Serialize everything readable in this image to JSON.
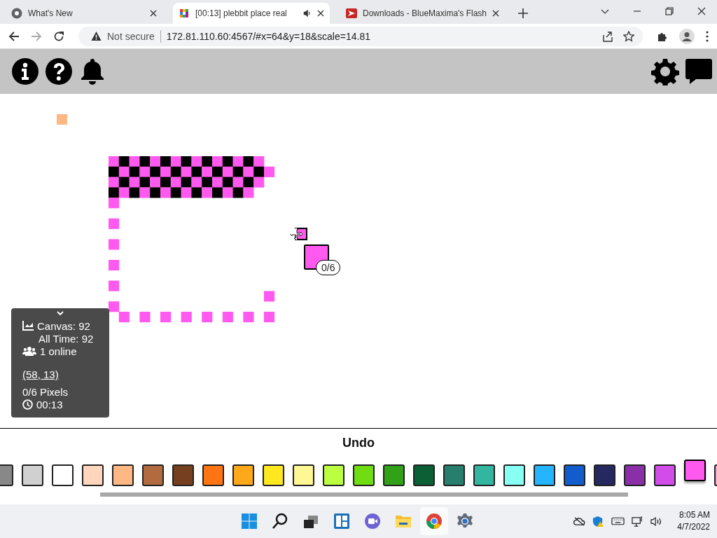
{
  "browser": {
    "tabs": [
      {
        "title": "What's New",
        "selected": false,
        "playing_audio": false,
        "kind": "chrome"
      },
      {
        "title": "[00:13] plebbit place real",
        "selected": true,
        "playing_audio": true,
        "kind": "grid"
      },
      {
        "title": "Downloads - BlueMaxima's Flash",
        "selected": false,
        "playing_audio": false,
        "kind": "flash"
      }
    ],
    "address_bar": {
      "security": "Not secure",
      "url": "172.81.110.60:4567/#x=64&y=18&scale=14.81"
    }
  },
  "canvas": {
    "pixel_counter": "0/6"
  },
  "info_panel": {
    "canvas_count": "Canvas: 92",
    "all_time": "All Time: 92",
    "online": "1 online",
    "coordinates": "(58, 13)",
    "pixels": "0/6 Pixels",
    "timer": "00:13"
  },
  "bottom_bar": {
    "undo": "Undo",
    "palette": [
      {
        "color": "#888888",
        "selected": false
      },
      {
        "color": "#d0d0d0",
        "selected": false
      },
      {
        "color": "#ffffff",
        "selected": false
      },
      {
        "color": "#ffd5bc",
        "selected": false
      },
      {
        "color": "#ffb783",
        "selected": false
      },
      {
        "color": "#b26b3e",
        "selected": false
      },
      {
        "color": "#763f1e",
        "selected": false
      },
      {
        "color": "#ff7514",
        "selected": false
      },
      {
        "color": "#ffa91a",
        "selected": false
      },
      {
        "color": "#ffe81f",
        "selected": false
      },
      {
        "color": "#fff694",
        "selected": false
      },
      {
        "color": "#bbff40",
        "selected": false
      },
      {
        "color": "#70dd13",
        "selected": false
      },
      {
        "color": "#31a117",
        "selected": false
      },
      {
        "color": "#0b5f35",
        "selected": false
      },
      {
        "color": "#277e6c",
        "selected": false
      },
      {
        "color": "#32b69f",
        "selected": false
      },
      {
        "color": "#88fff3",
        "selected": false
      },
      {
        "color": "#24b5fe",
        "selected": false
      },
      {
        "color": "#125ccb",
        "selected": false
      },
      {
        "color": "#262960",
        "selected": false
      },
      {
        "color": "#8b2fa8",
        "selected": false
      },
      {
        "color": "#d24cea",
        "selected": false
      },
      {
        "color": "#ff59ef",
        "selected": true
      },
      {
        "color": "#ffa9d9",
        "selected": false
      }
    ]
  },
  "taskbar": {
    "time": "8:05 AM",
    "date": "4/7/2022"
  }
}
